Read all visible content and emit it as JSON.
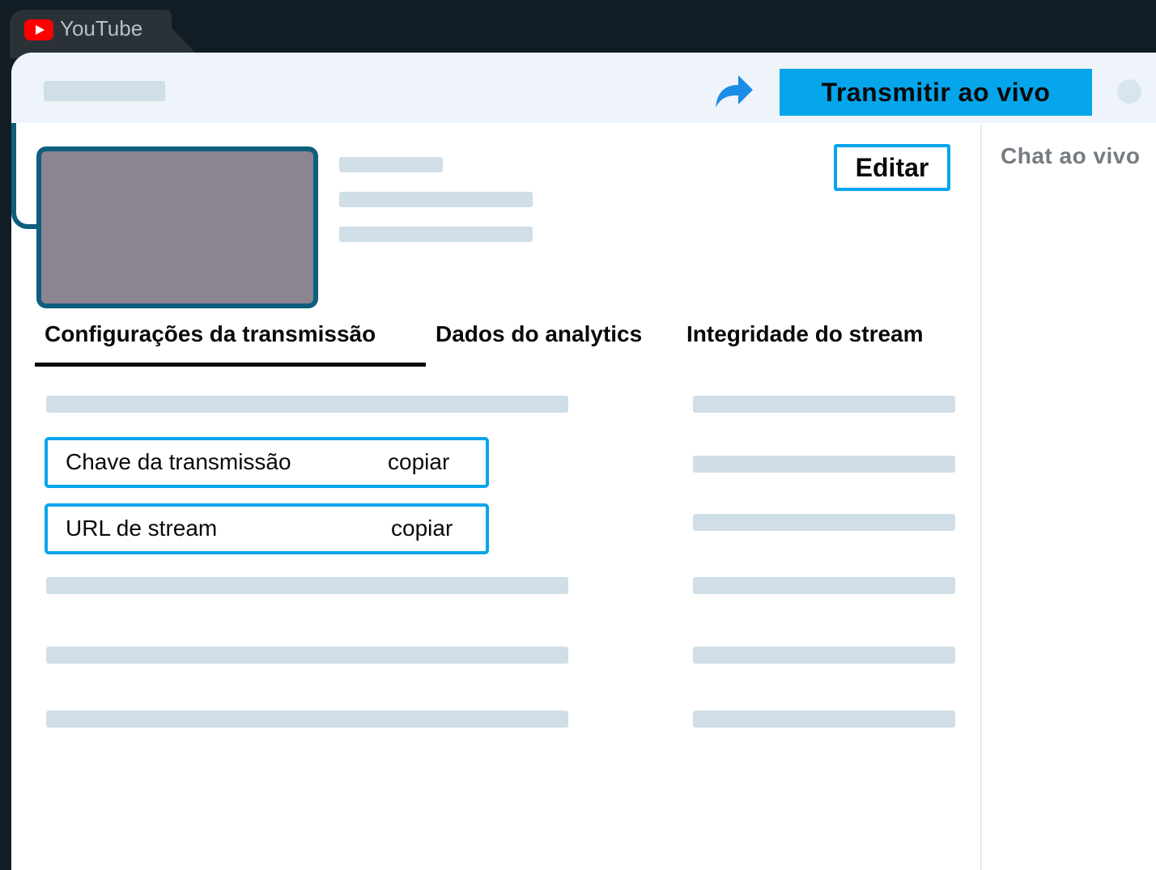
{
  "browser_tab": {
    "title": "YouTube"
  },
  "header": {
    "live_button_label": "Transmitir ao vivo"
  },
  "video": {
    "edit_label": "Editar"
  },
  "tabs": [
    {
      "label": "Configurações da transmissão",
      "active": true
    },
    {
      "label": "Dados do analytics",
      "active": false
    },
    {
      "label": "Integridade do stream",
      "active": false
    }
  ],
  "fields": [
    {
      "label": "Chave da transmissão",
      "action": "copiar"
    },
    {
      "label": "URL de stream",
      "action": "copiar"
    }
  ],
  "chat": {
    "title": "Chat ao vivo"
  },
  "colors": {
    "accent": "#05a5ec",
    "brand_red": "#ff0000",
    "placeholder": "#cfdee7",
    "frame": "#0e5f7c"
  },
  "icons": [
    "youtube-logo-icon",
    "share-arrow-icon"
  ]
}
